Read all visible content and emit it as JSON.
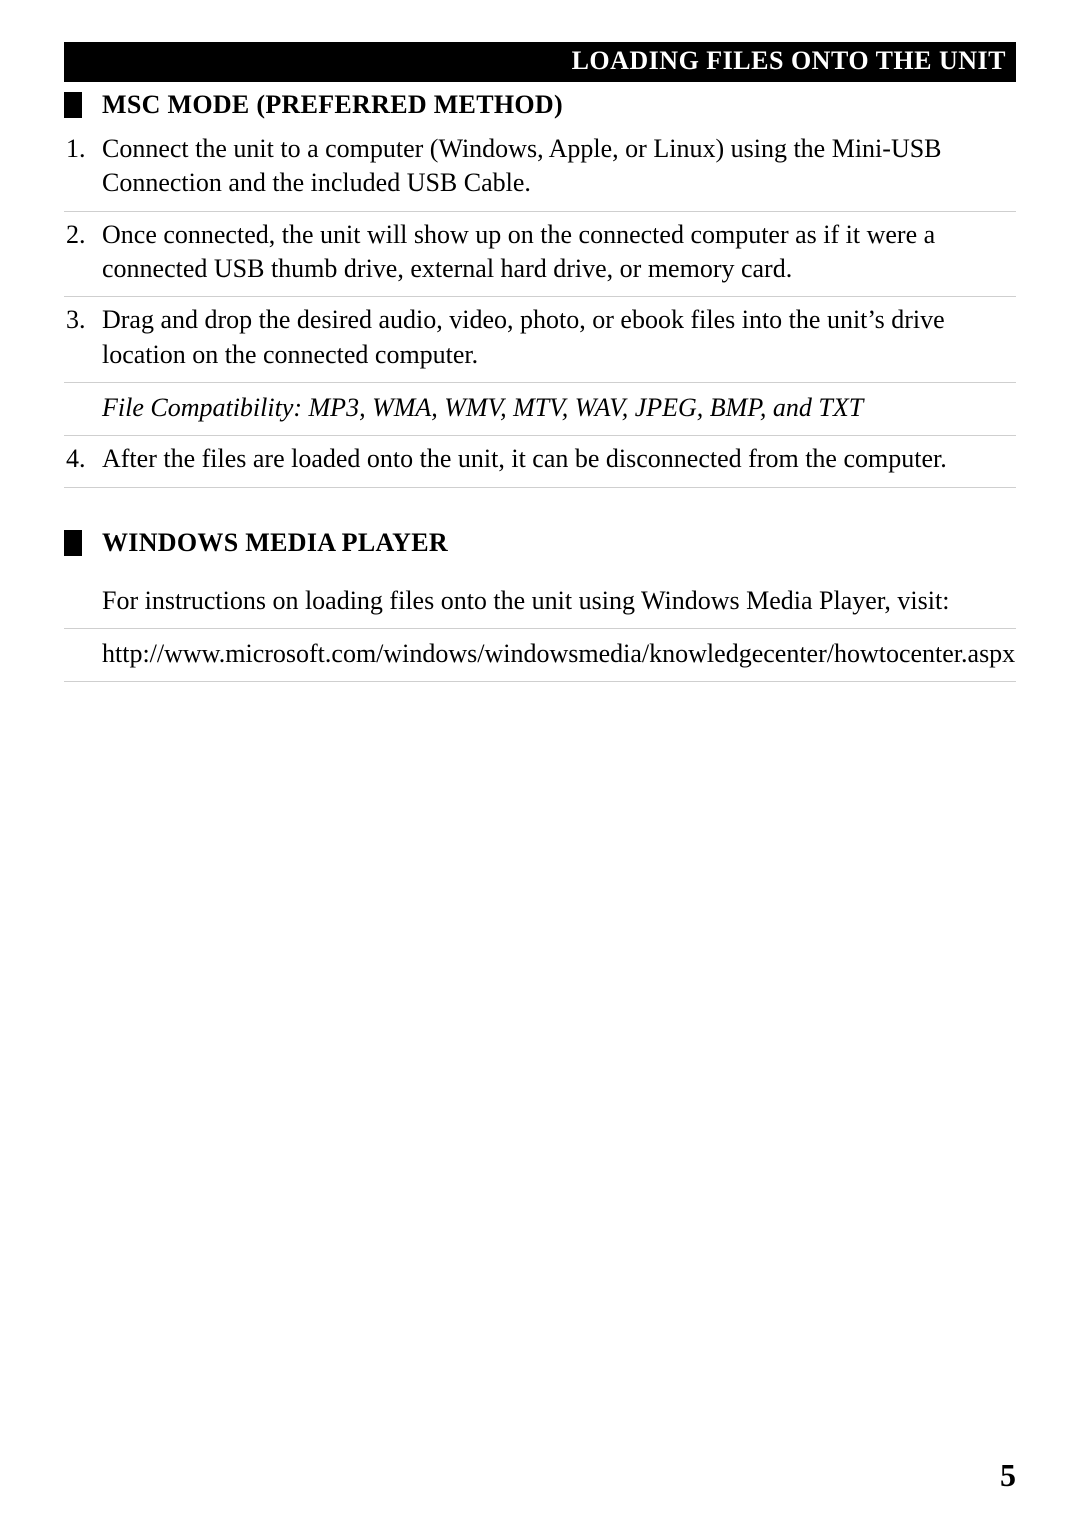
{
  "header": {
    "title": "LOADING FILES ONTO THE UNIT"
  },
  "section1": {
    "title": "MSC MODE (PREFERRED METHOD)",
    "items": {
      "n1": "1.",
      "t1": "Connect the unit to a computer (Windows, Apple, or Linux) using the Mini-USB Connection and the included USB Cable.",
      "n2": "2.",
      "t2": "Once connected, the unit will show up on the connected computer as if it were a connected USB thumb drive, external hard drive, or memory card.",
      "n3": "3.",
      "t3": "Drag and drop the desired audio, video, photo, or ebook files into the unit’s drive location on the connected computer.",
      "compat": "File Compatibility: MP3, WMA, WMV, MTV, WAV, JPEG, BMP, and TXT",
      "n4": "4.",
      "t4": "After the files are loaded onto the unit, it can be disconnected from the computer."
    }
  },
  "section2": {
    "title": "WINDOWS MEDIA PLAYER",
    "intro": "For instructions on loading files onto the unit using Windows Media Player, visit:",
    "url": "http://www.microsoft.com/windows/windowsmedia/knowledgecenter/howtocenter.aspx"
  },
  "page_number": "5"
}
